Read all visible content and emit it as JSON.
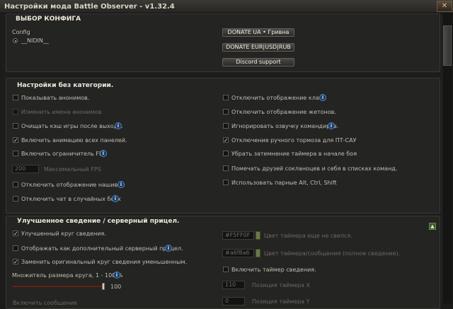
{
  "window": {
    "title": "Настройки мода Battle Observer - v1.32.4",
    "close_label": "✕"
  },
  "config_section": {
    "title": "ВЫБОР КОНФИГА",
    "config_label": "Config",
    "selected_config": "__NIDIN__",
    "buttons": [
      "DONATE UA • Гривна",
      "DONATE EUR|USD|RUB",
      "Discord support"
    ]
  },
  "general_section": {
    "title": "Настройки без категории.",
    "left": [
      {
        "label": "Показывать анонимов.",
        "checked": false,
        "enabled": true,
        "info": false
      },
      {
        "label": "Изменить имена анонимов",
        "checked": false,
        "enabled": false,
        "info": false
      },
      {
        "label": "Очищать кэш игры после выхода.",
        "checked": false,
        "enabled": true,
        "info": true
      },
      {
        "label": "Включить анимацию всех панелей.",
        "checked": true,
        "enabled": true,
        "info": false
      },
      {
        "label": "Включить ограничитель FPS",
        "checked": false,
        "enabled": true,
        "info": true
      }
    ],
    "fps_value": "200",
    "fps_label": "Максимальный FPS",
    "left_bottom": [
      {
        "label": "Отключить отображение нашивок",
        "checked": false,
        "enabled": true,
        "info": true
      },
      {
        "label": "Отключить чат в случайных боях",
        "checked": false,
        "enabled": true,
        "info": true
      }
    ],
    "right": [
      {
        "label": "Отключить отображение клана",
        "checked": false,
        "info": true
      },
      {
        "label": "Отключить отображение жетонов.",
        "checked": false,
        "info": false
      },
      {
        "label": "Игнорировать озвучку командиров.",
        "checked": false,
        "info": true
      },
      {
        "label": "Отключение ручного тормоза для ПТ-САУ",
        "checked": true,
        "info": false
      },
      {
        "label": "Убрать затемнение таймера в начале боя",
        "checked": false,
        "info": false
      },
      {
        "label": "Помечать друзей сокланоцев и себя в списках команд.",
        "checked": false,
        "info": false
      },
      {
        "label": "Использовать парные Alt, Ctrl, Shift",
        "checked": false,
        "info": false
      }
    ]
  },
  "sight_section": {
    "title": "Улучшенное сведение / серверный прицел.",
    "left": [
      {
        "label": "Улучшенный круг сведения.",
        "checked": true,
        "info": false
      },
      {
        "label": "Отображать как дополнительный серверный прицел.",
        "checked": false,
        "info": true
      },
      {
        "label": "Заменить оригинальный круг сведения уменьшенным.",
        "checked": true,
        "info": false
      }
    ],
    "slider_label": "Множитель размера круга, 1 - 100 %",
    "slider_value": "100",
    "slider_fraction": 1.0,
    "right_colors": [
      {
        "value": "#F5FF0F",
        "label": "Цвет таймера еще не свелся."
      },
      {
        "value": "#a6f8a6",
        "label": "Цвет таймера/сообщения (полное сведение)."
      }
    ],
    "timer_checkbox": {
      "label": "Включить таймер сведения.",
      "checked": false
    },
    "timer_x_value": "110",
    "timer_x_label": "Позиция таймера X",
    "timer_y_value": "0",
    "timer_y_label": "Позиция таймера Y",
    "collapse_label": "▲",
    "bottom_partial": "Включить сообщение"
  }
}
